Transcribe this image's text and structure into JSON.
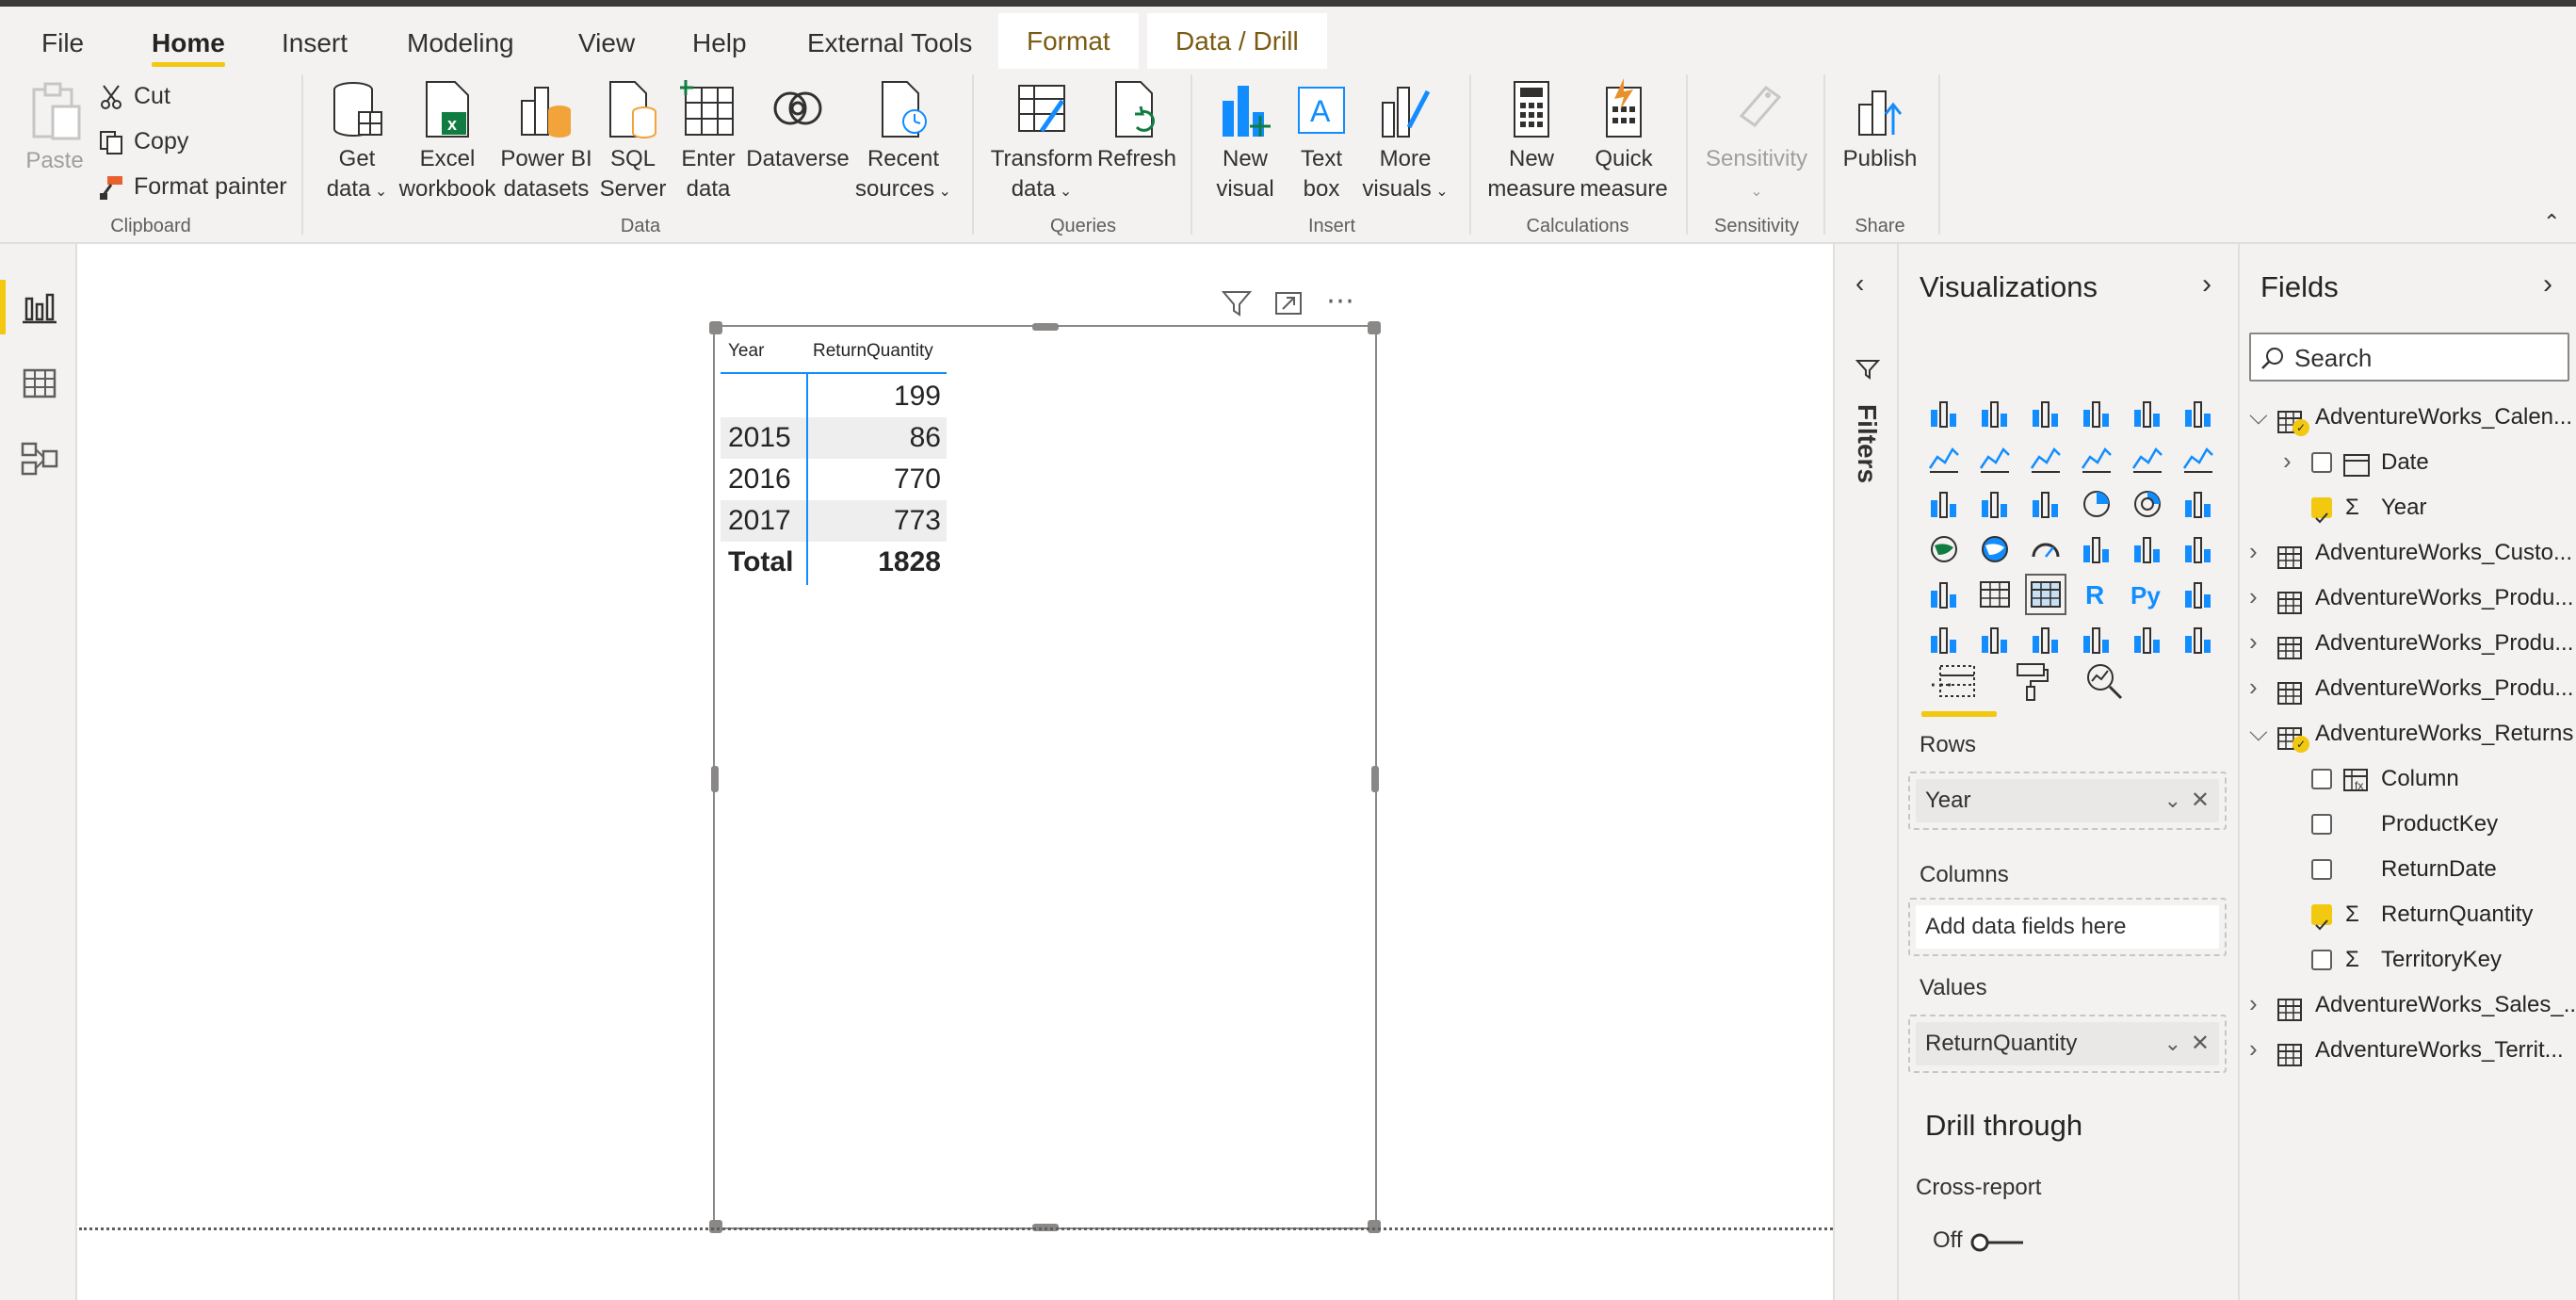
{
  "menu": {
    "tabs": [
      "File",
      "Home",
      "Insert",
      "Modeling",
      "View",
      "Help",
      "External Tools"
    ],
    "context_tabs": [
      "Format",
      "Data / Drill"
    ]
  },
  "ribbon": {
    "clipboard": {
      "paste": "Paste",
      "cut": "Cut",
      "copy": "Copy",
      "format_painter": "Format painter",
      "label": "Clipboard"
    },
    "data": {
      "get_data": [
        "Get",
        "data"
      ],
      "excel": [
        "Excel",
        "workbook"
      ],
      "pbi_datasets": [
        "Power BI",
        "datasets"
      ],
      "sql": [
        "SQL",
        "Server"
      ],
      "enter_data": [
        "Enter",
        "data"
      ],
      "dataverse": "Dataverse",
      "recent": [
        "Recent",
        "sources"
      ],
      "label": "Data"
    },
    "queries": {
      "transform": [
        "Transform",
        "data"
      ],
      "refresh": "Refresh",
      "label": "Queries"
    },
    "insert": {
      "new_visual": [
        "New",
        "visual"
      ],
      "text_box": [
        "Text",
        "box"
      ],
      "more_visuals": [
        "More",
        "visuals"
      ],
      "label": "Insert"
    },
    "calculations": {
      "new_measure": [
        "New",
        "measure"
      ],
      "quick_measure": [
        "Quick",
        "measure"
      ],
      "label": "Calculations"
    },
    "sensitivity": {
      "btn": "Sensitivity",
      "label": "Sensitivity"
    },
    "share": {
      "publish": "Publish",
      "label": "Share"
    }
  },
  "table_visual": {
    "headers": [
      "Year",
      "ReturnQuantity"
    ],
    "rows": [
      {
        "year": "",
        "value": "199"
      },
      {
        "year": "2015",
        "value": "86"
      },
      {
        "year": "2016",
        "value": "770"
      },
      {
        "year": "2017",
        "value": "773"
      }
    ],
    "total": {
      "label": "Total",
      "value": "1828"
    }
  },
  "filters_pane": {
    "label": "Filters"
  },
  "visualizations": {
    "title": "Visualizations",
    "wells": {
      "rows_label": "Rows",
      "rows_value": "Year",
      "columns_label": "Columns",
      "columns_placeholder": "Add data fields here",
      "values_label": "Values",
      "values_value": "ReturnQuantity"
    },
    "drill_through": "Drill through",
    "cross_report": "Cross-report",
    "toggle_state": "Off"
  },
  "fields": {
    "title": "Fields",
    "search_placeholder": "Search",
    "tables": [
      "AdventureWorks_Calen...",
      "Date",
      "Year",
      "AdventureWorks_Custo...",
      "AdventureWorks_Produ...",
      "AdventureWorks_Produ...",
      "AdventureWorks_Produ...",
      "AdventureWorks_Returns",
      "Column",
      "ProductKey",
      "ReturnDate",
      "ReturnQuantity",
      "TerritoryKey",
      "AdventureWorks_Sales_...",
      "AdventureWorks_Territ..."
    ]
  },
  "colors": {
    "accent": "#f2c811",
    "selection": "#118dff",
    "context_tab_text": "#7a5b12"
  }
}
